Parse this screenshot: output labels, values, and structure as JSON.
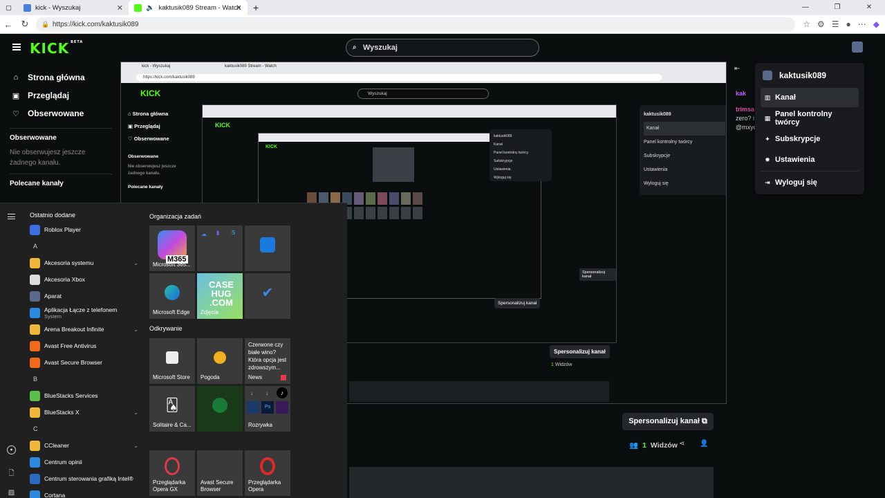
{
  "browser": {
    "tabs": [
      {
        "title": "kick - Wyszukaj",
        "active": false
      },
      {
        "title": "kaktusik089 Stream - Watch",
        "active": true
      }
    ],
    "new_tab": "+",
    "url": "https://kick.com/kaktusik089"
  },
  "kick": {
    "logo": "KICK",
    "logo_badge": "BETA",
    "search_placeholder": "Wyszukaj",
    "sidebar": {
      "nav": [
        {
          "label": "Strona główna",
          "icon": "home-icon"
        },
        {
          "label": "Przeglądaj",
          "icon": "browse-icon"
        },
        {
          "label": "Obserwowane",
          "icon": "heart-icon"
        }
      ],
      "following_title": "Obserwowane",
      "following_empty": "Nie obserwujesz jeszcze żadnego kanału.",
      "recommended_title": "Polecane kanały"
    },
    "dropdown": {
      "username": "kaktusik089",
      "items": [
        {
          "label": "Kanał",
          "icon": "channel-icon",
          "active": true
        },
        {
          "label": "Panel kontrolny twórcy",
          "icon": "dashboard-icon",
          "active": false
        },
        {
          "label": "Subskrypcje",
          "icon": "sparkle-icon",
          "active": false
        },
        {
          "label": "Ustawienia",
          "icon": "gear-icon",
          "active": false
        }
      ],
      "logout": "Wyloguj się"
    },
    "chat_peek": {
      "name1": "kak",
      "name2": "trimsa",
      "line1": "zero? i",
      "line2": "@mxyc"
    },
    "personalize_label": "Spersonalizuj kanał",
    "viewers_count": "1",
    "viewers_label": "Widzów"
  },
  "start_menu": {
    "recent_header": "Ostatnio dodane",
    "apps": [
      {
        "type": "app",
        "name": "Roblox Player",
        "color": "#3b6fe0"
      },
      {
        "type": "letter",
        "name": "A"
      },
      {
        "type": "folder",
        "name": "Akcesoria systemu"
      },
      {
        "type": "app",
        "name": "Akcesoria Xbox",
        "color": "#dddddd"
      },
      {
        "type": "app",
        "name": "Aparat",
        "color": "#5a6a8a"
      },
      {
        "type": "app",
        "name": "Aplikacja Łącze z telefonem",
        "sub": "System",
        "color": "#2a8ae0"
      },
      {
        "type": "folder",
        "name": "Arena Breakout Infinite"
      },
      {
        "type": "app",
        "name": "Avast Free Antivirus",
        "color": "#f06a1a"
      },
      {
        "type": "app",
        "name": "Avast Secure Browser",
        "color": "#f06a1a"
      },
      {
        "type": "letter",
        "name": "B"
      },
      {
        "type": "app",
        "name": "BlueStacks Services",
        "color": "#5ac04a"
      },
      {
        "type": "folder",
        "name": "BlueStacks X"
      },
      {
        "type": "letter",
        "name": "C"
      },
      {
        "type": "folder",
        "name": "CCleaner"
      },
      {
        "type": "app",
        "name": "Centrum opinii",
        "color": "#2a8ae0"
      },
      {
        "type": "app",
        "name": "Centrum sterowania grafiką Intel®",
        "color": "#2a6ac0"
      },
      {
        "type": "app",
        "name": "Cortana",
        "color": "#2a8ae0"
      }
    ],
    "group1": "Organizacja zadań",
    "group2": "Odkrywanie",
    "tiles": {
      "m365": "Microsoft 365...",
      "m365_badge": "M365",
      "edge": "Microsoft Edge",
      "photos": "Zdjęcia",
      "casehug": "CASE HUG .COM",
      "store": "Microsoft Store",
      "weather": "Pogoda",
      "news_text": "Czerwone czy białe wino? Która opcja jest zdrowszym...",
      "news": "News",
      "solitaire": "Solitaire & Ca...",
      "rozrywka": "Rozrywka",
      "opera_gx": "Przeglądarka Opera GX",
      "avast_browser": "Avast Secure Browser",
      "opera": "Przeglądarka Opera"
    }
  }
}
